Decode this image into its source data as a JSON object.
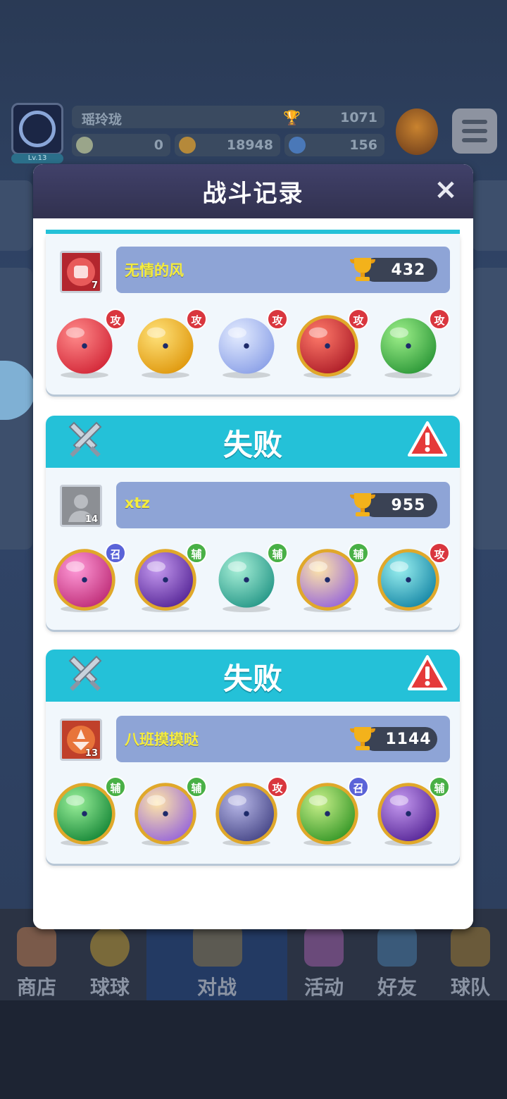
{
  "background": {
    "player_name": "瑶玲珑",
    "level": "Lv.13",
    "trophies": "1071",
    "resource_1": "0",
    "resource_2": "18948",
    "resource_3": "156"
  },
  "nav": {
    "items": [
      "商店",
      "球球",
      "对战",
      "活动",
      "好友",
      "球队"
    ]
  },
  "dialog": {
    "title": "战斗记录",
    "close_icon": "×"
  },
  "records": [
    {
      "result": "",
      "opponent": "无情的风",
      "level": "7",
      "trophies": "432",
      "balls": [
        {
          "icon": "fire-ball-icon",
          "tag": "攻",
          "tag_color": "#d9363e"
        },
        {
          "icon": "lightning-ball-icon",
          "tag": "攻",
          "tag_color": "#d9363e"
        },
        {
          "icon": "bubble-ball-icon",
          "tag": "攻",
          "tag_color": "#d9363e"
        },
        {
          "icon": "fist-ball-icon",
          "tag": "攻",
          "tag_color": "#d9363e"
        },
        {
          "icon": "poison-skull-ball-icon",
          "tag": "攻",
          "tag_color": "#d9363e"
        }
      ]
    },
    {
      "result": "失败",
      "opponent": "xtz",
      "level": "14",
      "trophies": "955",
      "balls": [
        {
          "icon": "sword-ball-icon",
          "tag": "召",
          "tag_color": "#5a63d8"
        },
        {
          "icon": "leaf-ball-icon",
          "tag": "辅",
          "tag_color": "#49b046"
        },
        {
          "icon": "sp-ball-icon",
          "tag": "辅",
          "tag_color": "#49b046"
        },
        {
          "icon": "rainbow-ball-icon",
          "tag": "辅",
          "tag_color": "#49b046"
        },
        {
          "icon": "tornado-ball-icon",
          "tag": "攻",
          "tag_color": "#d9363e"
        }
      ]
    },
    {
      "result": "失败",
      "opponent": "八班摸摸哒",
      "level": "13",
      "trophies": "1144",
      "balls": [
        {
          "icon": "star-arrow-ball-icon",
          "tag": "辅",
          "tag_color": "#49b046"
        },
        {
          "icon": "rainbow-ball-icon",
          "tag": "辅",
          "tag_color": "#49b046"
        },
        {
          "icon": "stone-ball-icon",
          "tag": "攻",
          "tag_color": "#d9363e"
        },
        {
          "icon": "hexagram-ball-icon",
          "tag": "召",
          "tag_color": "#5a63d8"
        },
        {
          "icon": "leaf-ball-icon",
          "tag": "辅",
          "tag_color": "#49b046"
        }
      ]
    }
  ]
}
